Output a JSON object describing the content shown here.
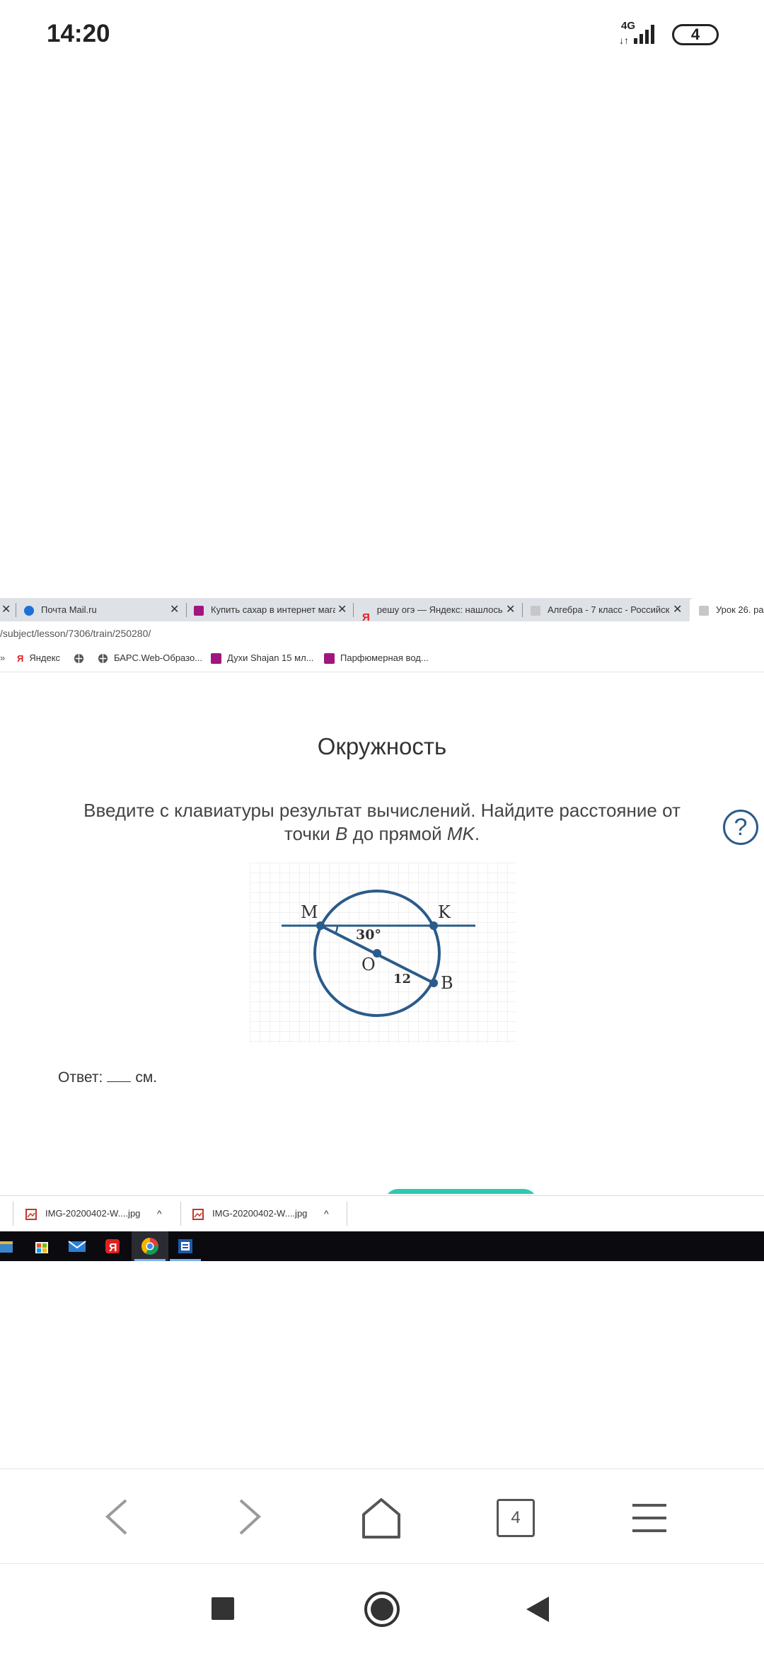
{
  "status": {
    "time": "14:20",
    "network": "4G",
    "network_arrows": "↓↑",
    "battery": "4"
  },
  "browser": {
    "tabs": [
      {
        "label": "Почта Mail.ru",
        "icon": "mail-ru-icon"
      },
      {
        "label": "Купить сахар в интернет мага",
        "icon": "wildberries-icon"
      },
      {
        "label": "решу огэ — Яндекс: нашлось",
        "icon": "yandex-icon"
      },
      {
        "label": "Алгебра - 7 класс - Российск",
        "icon": "resh-icon"
      },
      {
        "label": "Урок 26. ра",
        "icon": "resh-icon"
      }
    ],
    "url": "/subject/lesson/7306/train/250280/",
    "bookmarks": [
      {
        "label": "Яндекс",
        "icon": "yandex-icon"
      },
      {
        "label": "БАРС.Web-Образо...",
        "icon": "globe-icon"
      },
      {
        "label": "Духи Shajan 15 мл...",
        "icon": "wildberries-icon"
      },
      {
        "label": "Парфюмерная вод...",
        "icon": "wildberries-icon"
      }
    ]
  },
  "lesson": {
    "title": "Окружность",
    "task_part1": "Введите с клавиатуры результат вычислений. Найдите расстояние от точки ",
    "task_point_b": "B",
    "task_part2": " до прямой ",
    "task_line_mk": "MK",
    "task_end": ".",
    "help_label": "?",
    "answer_label": "Ответ:",
    "answer_unit": "см."
  },
  "figure": {
    "label_m": "M",
    "label_k": "K",
    "label_o": "O",
    "label_b": "B",
    "angle": "30°",
    "length": "12"
  },
  "downloads": [
    {
      "label": "IMG-20200402-W....jpg",
      "chevron": "^"
    },
    {
      "label": "IMG-20200402-W....jpg",
      "chevron": "^"
    }
  ],
  "nav": {
    "tab_count": "4"
  },
  "colors": {
    "figure_stroke": "#2a5b8a",
    "accent_teal": "#2fc8b0"
  }
}
